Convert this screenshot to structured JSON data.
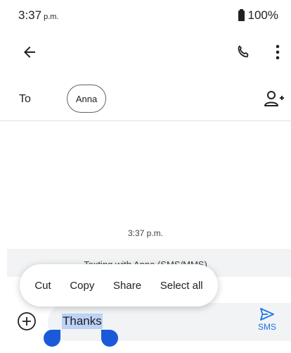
{
  "status_bar": {
    "time": "3:37",
    "ampm": "p.m.",
    "battery": "100%"
  },
  "header": {
    "back_icon": "arrow-back-icon",
    "call_icon": "phone-icon",
    "more_icon": "more-vert-icon"
  },
  "recipients": {
    "to_label": "To",
    "chips": [
      {
        "name": "Anna"
      }
    ],
    "add_icon": "add-person-icon"
  },
  "conversation": {
    "timestamp": "3:37 p.m.",
    "info": "Texting with Anna (SMS/MMS)"
  },
  "context_menu": {
    "items": [
      "Cut",
      "Copy",
      "Share",
      "Select all"
    ]
  },
  "compose": {
    "attach_icon": "add-circle-icon",
    "value": "Thanks",
    "send_icon": "send-icon",
    "send_label": "SMS"
  },
  "colors": {
    "accent": "#1a73e8",
    "selection": "#bcd2f6",
    "handle": "#1a5ad8"
  }
}
